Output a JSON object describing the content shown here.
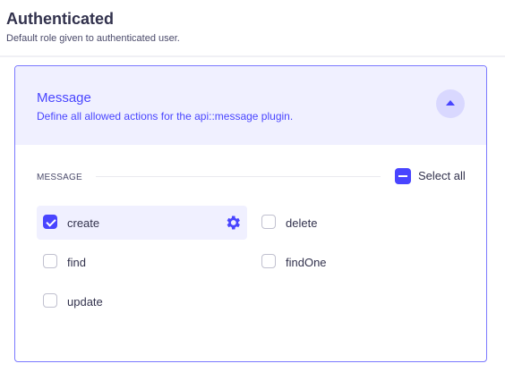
{
  "header": {
    "title": "Authenticated",
    "subtitle": "Default role given to authenticated user."
  },
  "plugin": {
    "title": "Message",
    "description": "Define all allowed actions for the api::message plugin.",
    "collapse_icon": "chevron-up-icon"
  },
  "section": {
    "label": "MESSAGE",
    "select_all_label": "Select all",
    "select_all_state": "indeterminate"
  },
  "permissions": [
    {
      "label": "create",
      "checked": true,
      "active": true
    },
    {
      "label": "delete",
      "checked": false
    },
    {
      "label": "find",
      "checked": false
    },
    {
      "label": "findOne",
      "checked": false
    },
    {
      "label": "update",
      "checked": false
    }
  ],
  "colors": {
    "accent": "#4945ff",
    "panel_bg": "#f0f0ff",
    "text": "#32324d"
  }
}
